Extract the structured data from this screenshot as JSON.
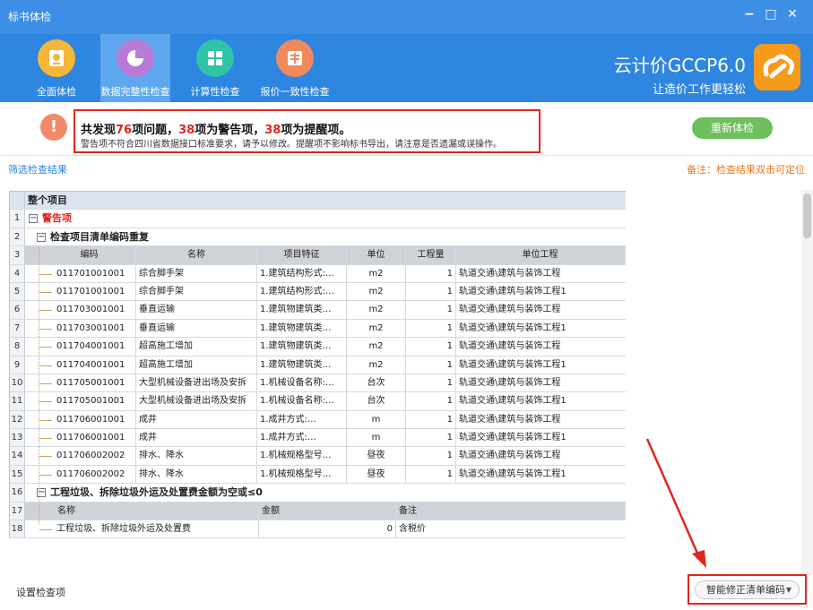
{
  "window": {
    "title": "标书体检",
    "minimize": "−",
    "maximize": "□",
    "close": "✕"
  },
  "toolbar": {
    "tools": [
      {
        "label": "全面体检",
        "icon": "report-icon",
        "color": "#f4b73a"
      },
      {
        "label": "数据完整性检查",
        "icon": "pie-chart-icon",
        "color": "#b77ad6",
        "active": true
      },
      {
        "label": "计算性检查",
        "icon": "grid-icon",
        "color": "#2ec4a8"
      },
      {
        "label": "报价一致性检查",
        "icon": "price-icon",
        "color": "#f08a5d"
      }
    ]
  },
  "brand": {
    "line1": "云计价GCCP6.0",
    "line2": "让造价工作更轻松"
  },
  "summary": {
    "p1": "共发现",
    "n_total": "76",
    "p2": "项问题，",
    "n_warn": "38",
    "p3": "项为警告项，",
    "n_remind": "38",
    "p4": "项为提醒项。",
    "detail": "警告项不符合四川省数据接口标准要求，请予以修改。提醒项不影响标书导出，请注意是否遗漏或误操作。"
  },
  "recheck_label": "重新体检",
  "filter_label": "筛选检查结果",
  "note_label": "备注：检查结果双击可定位",
  "grid": {
    "header": "整个项目",
    "warning_group": "警告项",
    "group1_title": "检查项目清单编码重复",
    "group1_columns": [
      "编码",
      "名称",
      "项目特征",
      "单位",
      "工程量",
      "单位工程"
    ],
    "group1_rows": [
      {
        "code": "011701001001",
        "name": "综合脚手架",
        "feature": "1.建筑结构形式:…",
        "unit": "m2",
        "qty": "1",
        "project": "轨道交通\\建筑与装饰工程"
      },
      {
        "code": "011701001001",
        "name": "综合脚手架",
        "feature": "1.建筑结构形式:…",
        "unit": "m2",
        "qty": "1",
        "project": "轨道交通\\建筑与装饰工程1"
      },
      {
        "code": "011703001001",
        "name": "垂直运输",
        "feature": "1.建筑物建筑类…",
        "unit": "m2",
        "qty": "1",
        "project": "轨道交通\\建筑与装饰工程"
      },
      {
        "code": "011703001001",
        "name": "垂直运输",
        "feature": "1.建筑物建筑类…",
        "unit": "m2",
        "qty": "1",
        "project": "轨道交通\\建筑与装饰工程1"
      },
      {
        "code": "011704001001",
        "name": "超高施工增加",
        "feature": "1.建筑物建筑类…",
        "unit": "m2",
        "qty": "1",
        "project": "轨道交通\\建筑与装饰工程"
      },
      {
        "code": "011704001001",
        "name": "超高施工增加",
        "feature": "1.建筑物建筑类…",
        "unit": "m2",
        "qty": "1",
        "project": "轨道交通\\建筑与装饰工程1"
      },
      {
        "code": "011705001001",
        "name": "大型机械设备进出场及安拆",
        "feature": "1.机械设备名称:…",
        "unit": "台次",
        "qty": "1",
        "project": "轨道交通\\建筑与装饰工程"
      },
      {
        "code": "011705001001",
        "name": "大型机械设备进出场及安拆",
        "feature": "1.机械设备名称:…",
        "unit": "台次",
        "qty": "1",
        "project": "轨道交通\\建筑与装饰工程1"
      },
      {
        "code": "011706001001",
        "name": "成井",
        "feature": "1.成井方式:…",
        "unit": "m",
        "qty": "1",
        "project": "轨道交通\\建筑与装饰工程"
      },
      {
        "code": "011706001001",
        "name": "成井",
        "feature": "1.成井方式:…",
        "unit": "m",
        "qty": "1",
        "project": "轨道交通\\建筑与装饰工程1"
      },
      {
        "code": "011706002002",
        "name": "排水、降水",
        "feature": "1.机械规格型号…",
        "unit": "昼夜",
        "qty": "1",
        "project": "轨道交通\\建筑与装饰工程"
      },
      {
        "code": "011706002002",
        "name": "排水、降水",
        "feature": "1.机械规格型号…",
        "unit": "昼夜",
        "qty": "1",
        "project": "轨道交通\\建筑与装饰工程1"
      }
    ],
    "group2_title": "工程垃圾、拆除垃圾外运及处置费金额为空或≤0",
    "group2_columns": [
      "名称",
      "金额",
      "备注"
    ],
    "group2_rows": [
      {
        "name": "工程垃圾、拆除垃圾外运及处置费",
        "amount": "0",
        "remark": "含税价"
      }
    ]
  },
  "settings_label": "设置检查项",
  "fix_button_label": "智能修正清单编码",
  "fix_caret": "▼"
}
